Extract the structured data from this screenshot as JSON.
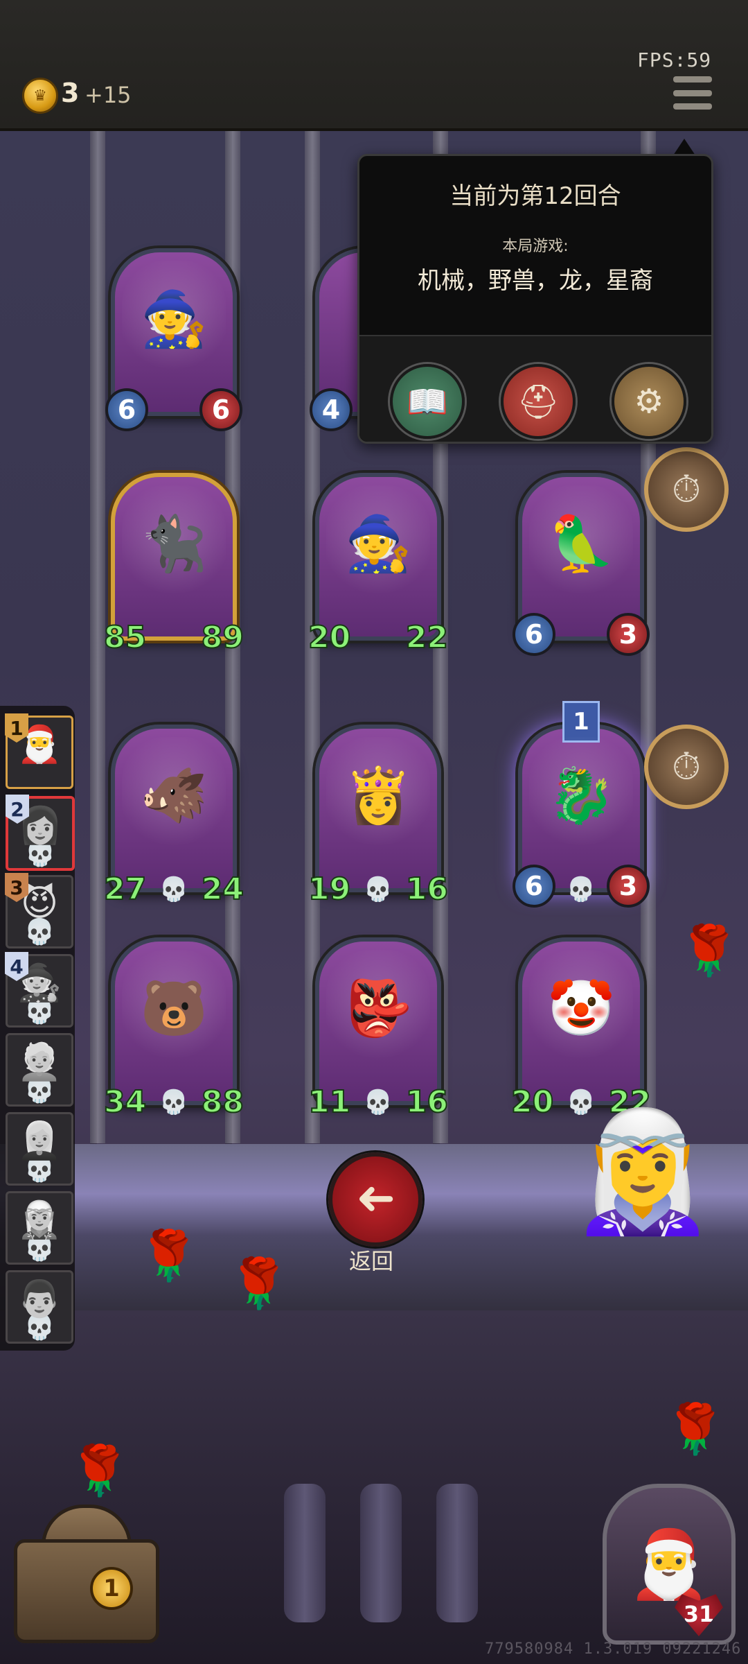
{
  "hud": {
    "coins": "3",
    "coin_income": "+15",
    "fps": "FPS:59",
    "build_info": "779580984 1.3.019 09221246"
  },
  "round_popup": {
    "title": "当前为第12回合",
    "this_game_label": "本局游戏:",
    "tribes": "机械，野兽，龙，星裔",
    "buttons": [
      "book-icon",
      "hero-helmet-icon",
      "gear-icon"
    ]
  },
  "board": {
    "units": [
      {
        "id": "wizard-top",
        "atk": "6",
        "hp": "6",
        "emoji": "🧙",
        "buffed": false
      },
      {
        "id": "partial-top",
        "atk": "4",
        "hp": "",
        "emoji": "🦊",
        "buffed": false
      },
      {
        "id": "pirate-cat",
        "atk": "85",
        "hp": "89",
        "emoji": "🐈‍⬛",
        "buffed": true,
        "golden": true
      },
      {
        "id": "wizard-mid",
        "atk": "20",
        "hp": "22",
        "emoji": "🧙",
        "buffed": true
      },
      {
        "id": "parrot",
        "atk": "6",
        "hp": "3",
        "emoji": "🦜",
        "buffed": false
      },
      {
        "id": "fire-beast",
        "atk": "27",
        "hp": "24",
        "emoji": "🐗",
        "buffed": true
      },
      {
        "id": "queen",
        "atk": "19",
        "hp": "16",
        "emoji": "👸",
        "buffed": true
      },
      {
        "id": "star-dragon",
        "atk": "6",
        "hp": "3",
        "emoji": "🐉",
        "buffed": false,
        "tier": "1"
      },
      {
        "id": "bear-pirate",
        "atk": "34",
        "hp": "88",
        "emoji": "🐻",
        "buffed": true
      },
      {
        "id": "goblin",
        "atk": "11",
        "hp": "16",
        "emoji": "👺",
        "buffed": true
      },
      {
        "id": "clown",
        "atk": "20",
        "hp": "22",
        "emoji": "🤡",
        "buffed": true
      }
    ]
  },
  "roster": {
    "slots": [
      {
        "rank": "1",
        "face": "🎅"
      },
      {
        "rank": "2",
        "face": "👩"
      },
      {
        "rank": "3",
        "face": "😈"
      },
      {
        "rank": "4",
        "face": "🧙"
      },
      {
        "rank": "",
        "face": "👱"
      },
      {
        "rank": "",
        "face": "👩‍🦳"
      },
      {
        "rank": "",
        "face": "🧝"
      },
      {
        "rank": "",
        "face": "👨"
      }
    ]
  },
  "back_button": {
    "label": "返回"
  },
  "treasure": {
    "count": "1"
  },
  "hero": {
    "health": "31",
    "emoji": "🎅"
  },
  "colors": {
    "accent_red": "#c2242a",
    "gold": "#d79a14",
    "buff_green": "#8cf078"
  }
}
